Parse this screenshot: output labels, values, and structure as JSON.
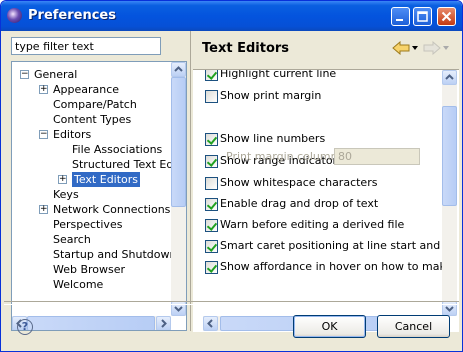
{
  "window": {
    "title": "Preferences"
  },
  "filter": {
    "value": "type filter text"
  },
  "tree": {
    "items": [
      {
        "label": "General",
        "depth": 0,
        "expander": "−"
      },
      {
        "label": "Appearance",
        "depth": 1,
        "expander": "+"
      },
      {
        "label": "Compare/Patch",
        "depth": 1,
        "expander": ""
      },
      {
        "label": "Content Types",
        "depth": 1,
        "expander": ""
      },
      {
        "label": "Editors",
        "depth": 1,
        "expander": "−"
      },
      {
        "label": "File Associations",
        "depth": 2,
        "expander": ""
      },
      {
        "label": "Structured Text Ed",
        "depth": 2,
        "expander": ""
      },
      {
        "label": "Text Editors",
        "depth": 2,
        "expander": "+",
        "selected": true
      },
      {
        "label": "Keys",
        "depth": 1,
        "expander": ""
      },
      {
        "label": "Network Connections",
        "depth": 1,
        "expander": "+"
      },
      {
        "label": "Perspectives",
        "depth": 1,
        "expander": ""
      },
      {
        "label": "Search",
        "depth": 1,
        "expander": ""
      },
      {
        "label": "Startup and Shutdown",
        "depth": 1,
        "expander": ""
      },
      {
        "label": "Web Browser",
        "depth": 1,
        "expander": ""
      },
      {
        "label": "Welcome",
        "depth": 1,
        "expander": ""
      }
    ]
  },
  "page": {
    "title": "Text Editors",
    "print_margin_label": "Print margin column:",
    "print_margin_value": "80",
    "options": [
      {
        "label": "Highlight current line",
        "checked": true
      },
      {
        "label": "Show print margin",
        "checked": false
      },
      {
        "label": "Show line numbers",
        "checked": true
      },
      {
        "label": "Show range indicator",
        "checked": true
      },
      {
        "label": "Show whitespace characters",
        "checked": false
      },
      {
        "label": "Enable drag and drop of text",
        "checked": true
      },
      {
        "label": "Warn before editing a derived file",
        "checked": true
      },
      {
        "label": "Smart caret positioning at line start and en",
        "checked": true
      },
      {
        "label": "Show affordance in hover on how to make",
        "checked": true
      }
    ]
  },
  "buttons": {
    "ok": "OK",
    "cancel": "Cancel",
    "help": "?"
  },
  "colors": {
    "selection": "#316ac5",
    "titlebar": "#0454de",
    "checkmark": "#21a121"
  }
}
